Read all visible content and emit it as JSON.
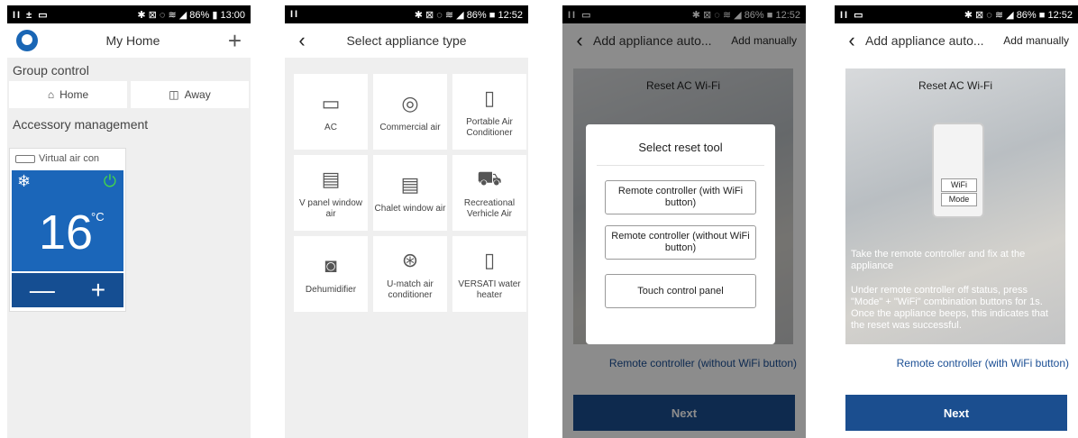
{
  "status": {
    "p1": {
      "left": "II ± ▭",
      "right": "✱ ⊠ ◌ ≋ ◢ 86% ▮ 13:00"
    },
    "p2": {
      "left": "II",
      "right": "✱ ⊠ ◌ ≋ ◢ 86% ■ 12:52"
    },
    "p3": {
      "left": "II ▭",
      "right": "✱ ⊠ ◌ ≋ ◢ 86% ■ 12:52"
    },
    "p4": {
      "left": "II ▭",
      "right": "✱ ⊠ ◌ ≋ ◢ 86% ■ 12:52"
    }
  },
  "home": {
    "title": "My Home",
    "plus": "+",
    "group_label": "Group control",
    "home_btn": "Home",
    "away_btn": "Away",
    "accessory_label": "Accessory management",
    "device": {
      "name": "Virtual air con",
      "temp": "16",
      "unit": "°C",
      "minus": "—",
      "plus": "+",
      "snow": "❄",
      "power": "⏻"
    }
  },
  "select": {
    "title": "Select appliance type",
    "items": [
      {
        "label": "AC",
        "icon": "▭"
      },
      {
        "label": "Commercial air",
        "icon": "◎"
      },
      {
        "label": "Portable Air Conditioner",
        "icon": "▯"
      },
      {
        "label": "V panel window air",
        "icon": "▤"
      },
      {
        "label": "Chalet window air",
        "icon": "▤"
      },
      {
        "label": "Recreational Verhicle Air",
        "icon": "⛟"
      },
      {
        "label": "Dehumidifier",
        "icon": "◙"
      },
      {
        "label": "U-match air conditioner",
        "icon": "⊛"
      },
      {
        "label": "VERSATI water heater",
        "icon": "▯"
      }
    ]
  },
  "auto": {
    "title": "Add appliance auto...",
    "manual": "Add manually",
    "illus_title": "Reset AC Wi-Fi",
    "next": "Next",
    "link3": "Remote controller (without WiFi button)",
    "link4": "Remote controller (with WiFi button)",
    "dialog": {
      "title": "Select reset tool",
      "options": [
        "Remote controller (with WiFi button)",
        "Remote controller (without WiFi button)",
        "Touch control panel"
      ]
    },
    "wifi_label": "WiFi",
    "mode_label": "Mode",
    "instr1": "Take the remote controller and fix at the appliance",
    "instr2": "Under remote controller off status, press \"Mode\" + \"WiFi\" combination buttons for 1s. Once the appliance beeps, this indicates that the reset was successful."
  }
}
